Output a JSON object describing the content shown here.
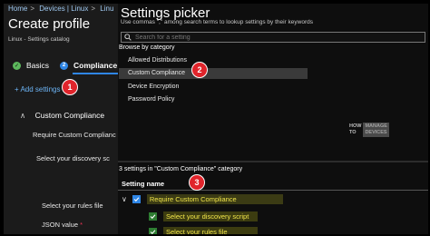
{
  "breadcrumb": [
    "Home",
    "Devices | Linux",
    "Linu"
  ],
  "page_title": "Create profile",
  "subtitle": "Linux - Settings catalog",
  "steps": [
    {
      "label": "Basics",
      "state": "done"
    },
    {
      "label": "Compliance",
      "state": "active"
    }
  ],
  "add_settings": "+ Add settings",
  "category_row": "Custom Compliance",
  "left_fields": {
    "require": "Require Custom Complianc",
    "discovery": "Select your discovery sc",
    "rules": "Select your rules file",
    "json": "JSON value"
  },
  "picker": {
    "title": "Settings picker",
    "hint": "Use commas \",\" among search terms to lookup settings by their keywords",
    "search_placeholder": "Search for a setting",
    "browse_label": "Browse by category",
    "categories": [
      "Allowed Distributions",
      "Custom Compliance",
      "Device Encryption",
      "Password Policy"
    ],
    "selected_category": "Custom Compliance",
    "count_label": "3 settings in \"Custom Compliance\" category",
    "column_header": "Setting name",
    "settings": [
      {
        "label": "Require Custom Compliance",
        "checked": true
      },
      {
        "label": "Select your discovery script",
        "checked": true
      },
      {
        "label": "Select your rules file",
        "checked": true
      }
    ]
  },
  "badges": [
    "1",
    "2",
    "3"
  ],
  "watermark": {
    "left": [
      "HOW",
      "TO"
    ],
    "right": [
      "MANAGE",
      "DEVICES"
    ]
  },
  "colors": {
    "accent": "#2f86e6",
    "badge": "#e0242b",
    "highlight_text": "#f2e64a"
  }
}
